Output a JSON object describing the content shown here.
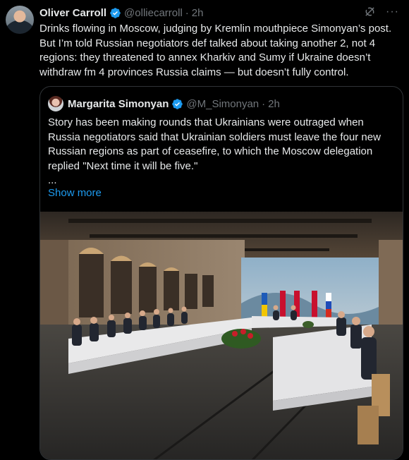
{
  "tweet": {
    "author_name": "Oliver Carroll",
    "author_handle": "@olliecarroll",
    "separator": "·",
    "time": "2h",
    "text": "Drinks flowing in Moscow, judging by Kremlin mouthpiece Simonyan’s post. But I’m told Russian negotiators def talked about taking another 2, not 4 regions: they threatened to annex Kharkiv and Sumy if Ukraine doesn’t withdraw fm 4 provinces Russia claims — but doesn’t fully control.",
    "more_icon": "···"
  },
  "quote": {
    "author_name": "Margarita Simonyan",
    "author_handle": "@M_Simonyan",
    "separator": "·",
    "time": "2h",
    "text": "Story has been making rounds that Ukrainians were outraged when Russia negotiators said that Ukrainian soldiers must leave the four new Russian regions as part of ceasefire, to which the Moscow delegation replied \"Next time it will be five.\"",
    "ellipsis": "...",
    "show_more": "Show more"
  },
  "colors": {
    "background": "#000000",
    "text": "#e7e9ea",
    "muted": "#71767b",
    "link": "#1d9bf0",
    "verified": "#1d9bf0",
    "border": "#2f3336"
  },
  "icons": [
    "verified-badge-icon",
    "grok-icon",
    "more-icon"
  ]
}
